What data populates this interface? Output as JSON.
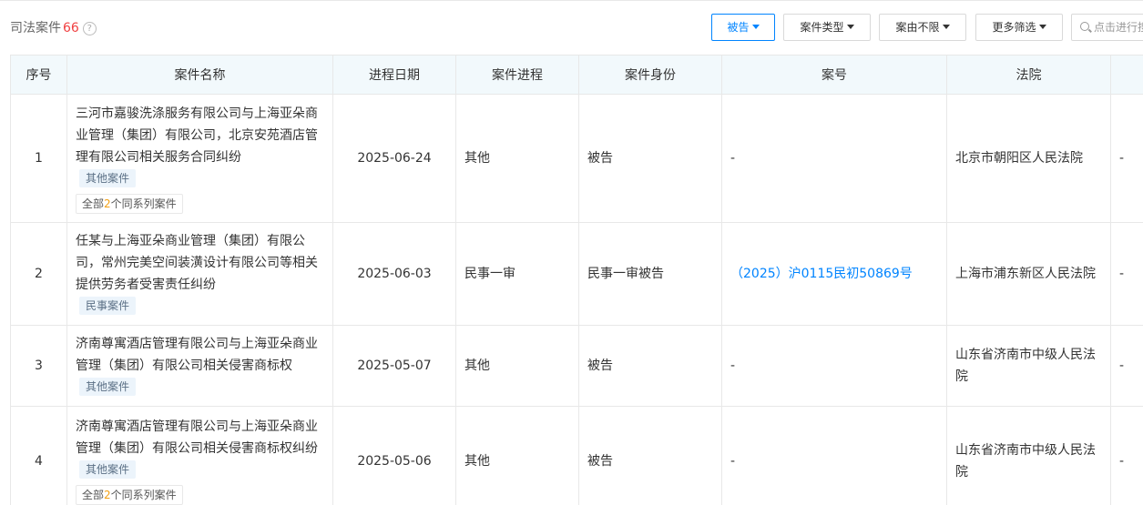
{
  "header": {
    "title": "司法案件",
    "count": "66",
    "help_icon": "question-circle-icon"
  },
  "filters": {
    "defendant": "被告",
    "case_type": "案件类型",
    "cause": "案由不限",
    "more": "更多筛选",
    "search_placeholder": "点击进行搜索"
  },
  "colors": {
    "accent": "#0084ff",
    "count": "#f04142",
    "header_bg": "#f2f9fc"
  },
  "table": {
    "columns": [
      "序号",
      "案件名称",
      "进程日期",
      "案件进程",
      "案件身份",
      "案号",
      "法院"
    ],
    "rows": [
      {
        "index": "1",
        "name": "三河市嘉骏洗涤服务有限公司与上海亚朵商业管理（集团）有限公司，北京安苑酒店管理有限公司相关服务合同纠纷",
        "tag": "其他案件",
        "series_prefix": "全部",
        "series_count": "2",
        "series_suffix": "个同系列案件",
        "date": "2025-06-24",
        "progress": "其他",
        "role": "被告",
        "case_no": "-",
        "court": "北京市朝阳区人民法院",
        "extra": "-"
      },
      {
        "index": "2",
        "name": "任某与上海亚朵商业管理（集团）有限公司，常州完美空间装潢设计有限公司等相关提供劳务者受害责任纠纷",
        "tag": "民事案件",
        "date": "2025-06-03",
        "progress": "民事一审",
        "role": "民事一审被告",
        "case_no": "（2025）沪0115民初50869号",
        "court": "上海市浦东新区人民法院",
        "extra": "-"
      },
      {
        "index": "3",
        "name": "济南尊寓酒店管理有限公司与上海亚朵商业管理（集团）有限公司相关侵害商标权",
        "tag": "其他案件",
        "date": "2025-05-07",
        "progress": "其他",
        "role": "被告",
        "case_no": "-",
        "court": "山东省济南市中级人民法院",
        "extra": "-"
      },
      {
        "index": "4",
        "name": "济南尊寓酒店管理有限公司与上海亚朵商业管理（集团）有限公司相关侵害商标权纠纷",
        "tag": "其他案件",
        "series_prefix": "全部",
        "series_count": "2",
        "series_suffix": "个同系列案件",
        "date": "2025-05-06",
        "progress": "其他",
        "role": "被告",
        "case_no": "-",
        "court": "山东省济南市中级人民法院",
        "extra": "-"
      }
    ]
  }
}
